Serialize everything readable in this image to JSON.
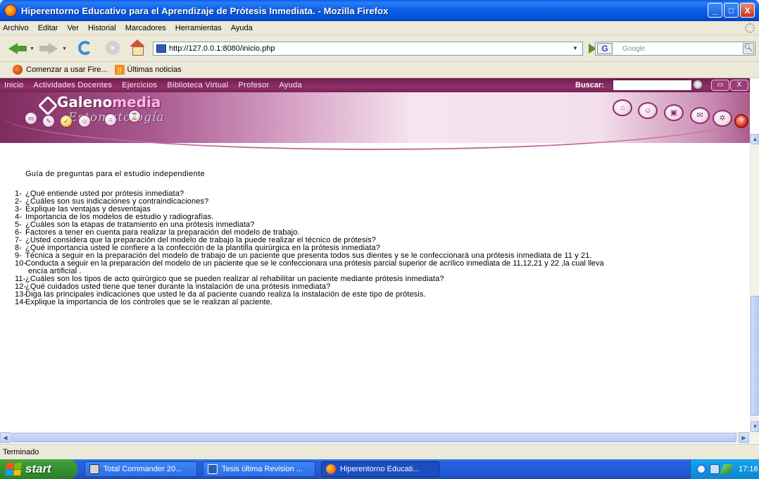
{
  "window": {
    "title": "Hiperentorno Educativo para el Aprendizaje de Prótesis Inmediata. - Mozilla Firefox",
    "controls": [
      "_",
      "□",
      "X"
    ]
  },
  "menu": [
    "Archivo",
    "Editar",
    "Ver",
    "Historial",
    "Marcadores",
    "Herramientas",
    "Ayuda"
  ],
  "toolbar": {
    "url": "http://127.0.0.1:8080/inicio.php",
    "search_engine": "G",
    "search_placeholder": "Google"
  },
  "bookmarks": [
    "Comenzar a usar Fire...",
    "Últimas noticias"
  ],
  "site": {
    "nav": [
      "Inicio",
      "Actividades Docentes",
      "Ejercicios",
      "Biblioteca Virtual",
      "Profesor",
      "Ayuda"
    ],
    "search_label": "Buscar:",
    "logo_main_a": "Galeno",
    "logo_main_b": "media",
    "logo_sub": "Estomatología"
  },
  "content": {
    "title": "Guía  de preguntas para el estudio independiente",
    "questions": [
      {
        "num": "1-",
        "text": "¿Qué entiende usted  por prótesis inmediata?"
      },
      {
        "num": "2-",
        "text": "¿Cuáles son sus indicaciones  y contraindicaciones?"
      },
      {
        "num": "3-",
        "text": "Explique las ventajas y desventajas"
      },
      {
        "num": "4-",
        "text": "Importancia  de los modelos de estudio y radiografías."
      },
      {
        "num": "5-",
        "text": "¿Cuáles son la etapas de tratamiento en una prótesis inmediata?"
      },
      {
        "num": "6-",
        "text": "Factores a tener  en cuenta  para realizar la preparación  del modelo  de trabajo."
      },
      {
        "num": "7-",
        "text": "¿Usted considera que la preparación  del modelo de trabajo  la puede realizar el técnico de prótesis?"
      },
      {
        "num": "8-",
        "text": "¿Qué importancia usted le confiere a la confección  de la plantilla quirúrgica en la prótesis inmediata?"
      },
      {
        "num": "9-",
        "text": "Técnica a seguir  en la preparación  del modelo de trabajo  de un paciente  que presenta  todos sus dientes y se le confeccionará  una prótesis  inmediata  de 11 y 21."
      },
      {
        "num": "10-",
        "text": "Conducta a seguir  en la preparación  del modelo de un paciente que se le confeccionara  una prótesis  parcial  superior de acrílico  inmediata  de 11,12,21 y 22 ,la cual lleva",
        "cont": "encía artificial ."
      },
      {
        "num": "11-",
        "text": "¿Cuáles son los tipos de acto quirúrgico que se pueden realizar al rehabilitar un paciente mediante prótesis inmediata?"
      },
      {
        "num": "12-",
        "text": "¿Qué cuidados usted tiene que tener durante la instalación de una prótesis inmediata?"
      },
      {
        "num": "13-",
        "text": "Diga las principales indicaciones que usted le da al paciente cuando realiza la instalación de este tipo de prótesis."
      },
      {
        "num": "14-",
        "text": "Explique la importancia de los controles que se le realizan al paciente."
      }
    ]
  },
  "status": "Terminado",
  "taskbar": {
    "start": "start",
    "tasks": [
      "Total Commander 20...",
      "Tesis última Revision ...",
      "Hiperentorno Educati..."
    ],
    "clock": "17:18"
  }
}
